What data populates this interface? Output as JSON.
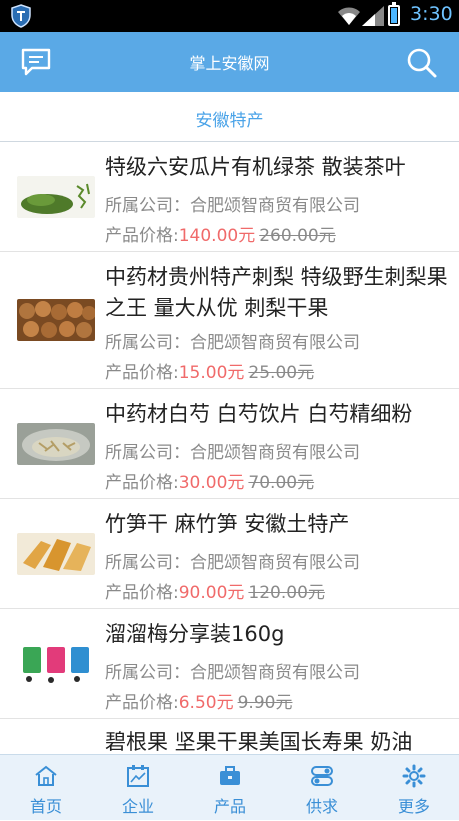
{
  "status_bar": {
    "time": "3:30"
  },
  "app_bar": {
    "title": "掌上安徽网",
    "left_icon": "chat-icon",
    "right_icon": "search-icon"
  },
  "section": {
    "title": "安徽特产"
  },
  "products": [
    {
      "name": "特级六安瓜片有机绿茶 散装茶叶",
      "company": "所属公司：合肥颂智商贸有限公司",
      "price_label": "产品价格:",
      "price": "140.00元",
      "original_price": "260.00元"
    },
    {
      "name": "中药材贵州特产刺梨 特级野生刺梨果之王 量大从优 刺梨干果",
      "company": "所属公司：合肥颂智商贸有限公司",
      "price_label": "产品价格:",
      "price": "15.00元",
      "original_price": "25.00元"
    },
    {
      "name": "中药材白芍 白芍饮片 白芍精细粉",
      "company": "所属公司：合肥颂智商贸有限公司",
      "price_label": "产品价格:",
      "price": "30.00元",
      "original_price": "70.00元"
    },
    {
      "name": "竹笋干 麻竹笋 安徽土特产",
      "company": "所属公司：合肥颂智商贸有限公司",
      "price_label": "产品价格:",
      "price": "90.00元",
      "original_price": "120.00元"
    },
    {
      "name": "溜溜梅分享装160g",
      "company": "所属公司：合肥颂智商贸有限公司",
      "price_label": "产品价格:",
      "price": "6.50元",
      "original_price": "9.90元"
    },
    {
      "name": "碧根果 坚果干果美国长寿果 奶油",
      "company": "",
      "price_label": "",
      "price": "",
      "original_price": ""
    }
  ],
  "tabs": [
    {
      "label": "首页",
      "icon": "home-icon"
    },
    {
      "label": "企业",
      "icon": "building-icon"
    },
    {
      "label": "产品",
      "icon": "briefcase-icon"
    },
    {
      "label": "供求",
      "icon": "toggle-icon"
    },
    {
      "label": "更多",
      "icon": "gear-icon"
    }
  ],
  "colors": {
    "primary": "#5aa9e6",
    "accent_text": "#4aa3e8",
    "price": "#f06a6a",
    "tab_bg": "#e9f2fa"
  }
}
